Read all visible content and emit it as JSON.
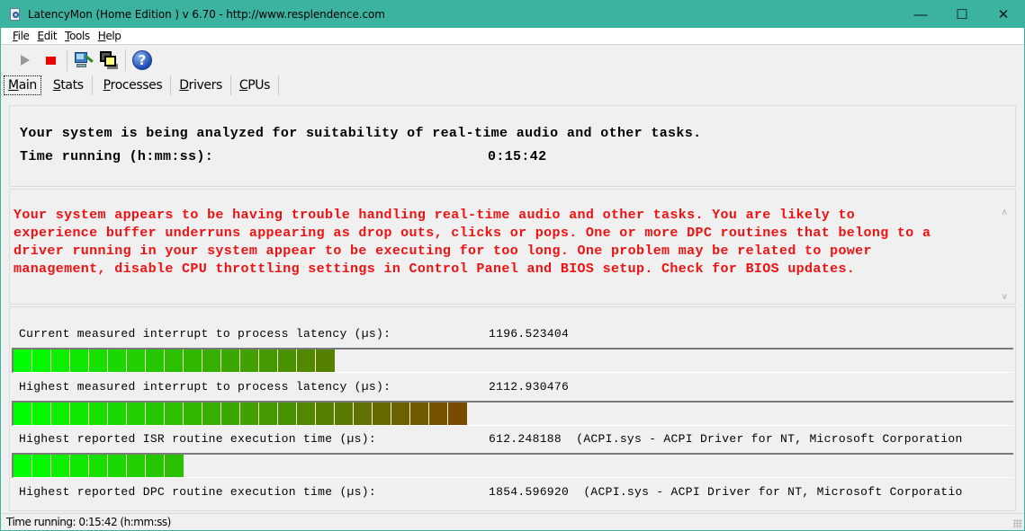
{
  "window": {
    "title": "LatencyMon  (Home Edition )  v 6.70 - http://www.resplendence.com",
    "controls": {
      "minimize": "—",
      "maximize": "☐",
      "close": "✕"
    },
    "app_icon": "magnifier-document-icon"
  },
  "menu": [
    {
      "label": "File",
      "accel": "F",
      "rest": "ile"
    },
    {
      "label": "Edit",
      "accel": "E",
      "rest": "dit"
    },
    {
      "label": "Tools",
      "accel": "T",
      "rest": "ools"
    },
    {
      "label": "Help",
      "accel": "H",
      "rest": "elp"
    }
  ],
  "toolbar": {
    "buttons": [
      {
        "name": "start",
        "icon": "play-icon",
        "enabled": false
      },
      {
        "name": "stop",
        "icon": "stop-icon",
        "enabled": true
      },
      {
        "name": "analyze",
        "icon": "computer-pen-icon"
      },
      {
        "name": "windows",
        "icon": "overlapping-windows-icon"
      },
      {
        "name": "help",
        "icon": "help-icon",
        "glyph": "?"
      }
    ]
  },
  "tabs": [
    {
      "label": "Main",
      "accel": "M",
      "rest": "ain",
      "active": true
    },
    {
      "label": "Stats",
      "accel": "S",
      "rest": "tats",
      "active": false
    },
    {
      "label": "Processes",
      "accel": "P",
      "rest": "rocesses",
      "active": false
    },
    {
      "label": "Drivers",
      "accel": "D",
      "rest": "rivers",
      "active": false
    },
    {
      "label": "CPUs",
      "accel": "C",
      "rest": "PUs",
      "active": false
    }
  ],
  "summary": {
    "line1": "Your system is being analyzed for suitability of real-time audio and other tasks.",
    "time_label": "Time running (h:mm:ss):",
    "time_value": "0:15:42"
  },
  "warning": {
    "text": "Your system appears to be having trouble handling real-time audio and other tasks. You are likely to\nexperience buffer underruns appearing as drop outs, clicks or pops. One or more DPC routines that belong to a\ndriver running in your system appear to be executing for too long. One problem may be related to power\nmanagement, disable CPU throttling settings in Control Panel and BIOS setup. Check for BIOS updates.",
    "color": "#ee1111"
  },
  "metrics": [
    {
      "label": "Current measured interrupt to process latency (µs):",
      "value": "1196.523404",
      "detail": "",
      "bar_segments": 17
    },
    {
      "label": "Highest measured interrupt to process latency (µs):",
      "value": "2112.930476",
      "detail": "",
      "bar_segments": 24
    },
    {
      "label": "Highest reported ISR routine execution time (µs):",
      "value": "612.248188",
      "detail": "(ACPI.sys - ACPI Driver for NT, Microsoft Corporation",
      "bar_segments": 9
    },
    {
      "label": "Highest reported DPC routine execution time (µs):",
      "value": "1854.596920",
      "detail": "(ACPI.sys - ACPI Driver for NT, Microsoft Corporatio",
      "bar_segments": null
    }
  ],
  "bar_colors": {
    "start": "#00ff00",
    "end": "#7a4a00"
  },
  "statusbar": {
    "text": "Time running: 0:15:42  (h:mm:ss)"
  }
}
